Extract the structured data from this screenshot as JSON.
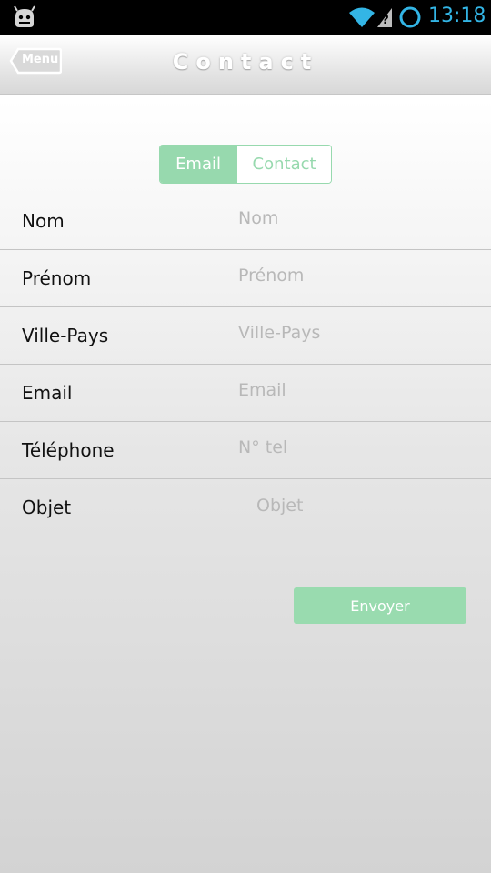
{
  "status_bar": {
    "time": "13:18",
    "accent_color": "#33b5e5",
    "icons": [
      "android-icon",
      "wifi-icon",
      "signal-unknown-icon",
      "sync-icon"
    ]
  },
  "header": {
    "menu_label": "Menu",
    "title": "Contact"
  },
  "segmented": {
    "email_label": "Email",
    "contact_label": "Contact",
    "selected": "Email",
    "accent_color": "#97d9ae"
  },
  "form": {
    "nom": {
      "label": "Nom",
      "placeholder": "Nom"
    },
    "prenom": {
      "label": "Prénom",
      "placeholder": "Prénom"
    },
    "ville": {
      "label": "Ville-Pays",
      "placeholder": "Ville-Pays"
    },
    "email": {
      "label": "Email",
      "placeholder": "Email"
    },
    "telephone": {
      "label": "Téléphone",
      "placeholder": "N° tel"
    },
    "objet": {
      "label": "Objet",
      "placeholder": "Objet"
    }
  },
  "send_button": {
    "label": "Envoyer"
  }
}
